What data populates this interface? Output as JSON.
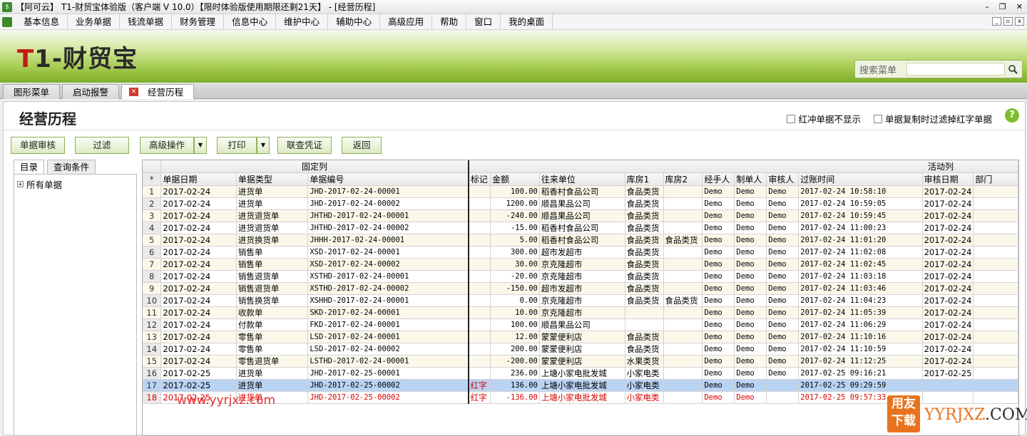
{
  "window": {
    "title": "【阿可云】 T1-财贸宝体验版（客户端 V 10.0）【限时体验版使用期限还剩21天】 - [经营历程]",
    "min": "–",
    "restore": "❐",
    "close": "✕"
  },
  "menu": [
    "基本信息",
    "业务单据",
    "钱流单据",
    "财务管理",
    "信息中心",
    "维护中心",
    "辅助中心",
    "高级应用",
    "帮助",
    "窗口",
    "我的桌面"
  ],
  "banner": {
    "logo_t": "T",
    "logo_rest": "1-财贸宝",
    "search_label": "搜索菜单",
    "search_value": ""
  },
  "tabs": [
    "图形菜单",
    "启动报警",
    "经营历程"
  ],
  "page": {
    "title": "经营历程",
    "opt1": "红冲单据不显示",
    "opt2": "单据复制时过滤掉红字单据",
    "help": "?"
  },
  "toolbar": {
    "audit": "单据审核",
    "filter": "过滤",
    "advanced": "高级操作",
    "print": "打印",
    "voucher": "联查凭证",
    "back": "返回"
  },
  "left": {
    "tab1": "目录",
    "tab2": "查询条件",
    "root": "所有单据"
  },
  "grid": {
    "group_fixed": "固定列",
    "group_active": "活动列",
    "headers": [
      "*",
      "单据日期",
      "单据类型",
      "单据编号",
      "标记",
      "金额",
      "往来单位",
      "库房1",
      "库房2",
      "经手人",
      "制单人",
      "审核人",
      "过账时间",
      "审核日期",
      "部门"
    ],
    "rows": [
      [
        "1",
        "2017-02-24",
        "进货单",
        "JHD-2017-02-24-00001",
        "",
        "100.00",
        "稻香村食品公司",
        "食品类货",
        "",
        "Demo",
        "Demo",
        "Demo",
        "2017-02-24 10:58:10",
        "2017-02-24",
        ""
      ],
      [
        "2",
        "2017-02-24",
        "进货单",
        "JHD-2017-02-24-00002",
        "",
        "1200.00",
        "顺昌果品公司",
        "食品类货",
        "",
        "Demo",
        "Demo",
        "Demo",
        "2017-02-24 10:59:05",
        "2017-02-24",
        ""
      ],
      [
        "3",
        "2017-02-24",
        "进货退货单",
        "JHTHD-2017-02-24-00001",
        "",
        "-240.00",
        "顺昌果品公司",
        "食品类货",
        "",
        "Demo",
        "Demo",
        "Demo",
        "2017-02-24 10:59:45",
        "2017-02-24",
        ""
      ],
      [
        "4",
        "2017-02-24",
        "进货退货单",
        "JHTHD-2017-02-24-00002",
        "",
        "-15.00",
        "稻香村食品公司",
        "食品类货",
        "",
        "Demo",
        "Demo",
        "Demo",
        "2017-02-24 11:00:23",
        "2017-02-24",
        ""
      ],
      [
        "5",
        "2017-02-24",
        "进货换货单",
        "JHHH-2017-02-24-00001",
        "",
        "5.00",
        "稻香村食品公司",
        "食品类货",
        "食品类货",
        "Demo",
        "Demo",
        "Demo",
        "2017-02-24 11:01:20",
        "2017-02-24",
        ""
      ],
      [
        "6",
        "2017-02-24",
        "销售单",
        "XSD-2017-02-24-00001",
        "",
        "300.00",
        "超市发超市",
        "食品类货",
        "",
        "Demo",
        "Demo",
        "Demo",
        "2017-02-24 11:02:08",
        "2017-02-24",
        ""
      ],
      [
        "7",
        "2017-02-24",
        "销售单",
        "XSD-2017-02-24-00002",
        "",
        "30.00",
        "京克隆超市",
        "食品类货",
        "",
        "Demo",
        "Demo",
        "Demo",
        "2017-02-24 11:02:45",
        "2017-02-24",
        ""
      ],
      [
        "8",
        "2017-02-24",
        "销售退货单",
        "XSTHD-2017-02-24-00001",
        "",
        "-20.00",
        "京克隆超市",
        "食品类货",
        "",
        "Demo",
        "Demo",
        "Demo",
        "2017-02-24 11:03:18",
        "2017-02-24",
        ""
      ],
      [
        "9",
        "2017-02-24",
        "销售退货单",
        "XSTHD-2017-02-24-00002",
        "",
        "-150.00",
        "超市发超市",
        "食品类货",
        "",
        "Demo",
        "Demo",
        "Demo",
        "2017-02-24 11:03:46",
        "2017-02-24",
        ""
      ],
      [
        "10",
        "2017-02-24",
        "销售换货单",
        "XSHHD-2017-02-24-00001",
        "",
        "0.00",
        "京克隆超市",
        "食品类货",
        "食品类货",
        "Demo",
        "Demo",
        "Demo",
        "2017-02-24 11:04:23",
        "2017-02-24",
        ""
      ],
      [
        "11",
        "2017-02-24",
        "收款单",
        "SKD-2017-02-24-00001",
        "",
        "10.00",
        "京克隆超市",
        "",
        "",
        "Demo",
        "Demo",
        "Demo",
        "2017-02-24 11:05:39",
        "2017-02-24",
        ""
      ],
      [
        "12",
        "2017-02-24",
        "付款单",
        "FKD-2017-02-24-00001",
        "",
        "100.00",
        "顺昌果品公司",
        "",
        "",
        "Demo",
        "Demo",
        "Demo",
        "2017-02-24 11:06:29",
        "2017-02-24",
        ""
      ],
      [
        "13",
        "2017-02-24",
        "零售单",
        "LSD-2017-02-24-00001",
        "",
        "12.00",
        "蒙蒙便利店",
        "食品类货",
        "",
        "Demo",
        "Demo",
        "Demo",
        "2017-02-24 11:10:16",
        "2017-02-24",
        ""
      ],
      [
        "14",
        "2017-02-24",
        "零售单",
        "LSD-2017-02-24-00002",
        "",
        "200.00",
        "蒙蒙便利店",
        "食品类货",
        "",
        "Demo",
        "Demo",
        "Demo",
        "2017-02-24 11:10:59",
        "2017-02-24",
        ""
      ],
      [
        "15",
        "2017-02-24",
        "零售退货单",
        "LSTHD-2017-02-24-00001",
        "",
        "-200.00",
        "蒙蒙便利店",
        "水果类货",
        "",
        "Demo",
        "Demo",
        "Demo",
        "2017-02-24 11:12:25",
        "2017-02-24",
        ""
      ],
      [
        "16",
        "2017-02-25",
        "进货单",
        "JHD-2017-02-25-00001",
        "",
        "236.00",
        "上塘小家电批发城",
        "小家电类",
        "",
        "Demo",
        "Demo",
        "Demo",
        "2017-02-25 09:16:21",
        "2017-02-25",
        ""
      ],
      [
        "17",
        "2017-02-25",
        "进货单",
        "JHD-2017-02-25-00002",
        "红字",
        "136.00",
        "上塘小家电批发城",
        "小家电类",
        "",
        "Demo",
        "Demo",
        "",
        "2017-02-25 09:29:59",
        "",
        ""
      ],
      [
        "18",
        "2017-02-25",
        "进货单",
        "JHD-2017-02-25-00002",
        "红字",
        "-136.00",
        "上塘小家电批发城",
        "小家电类",
        "",
        "Demo",
        "Demo",
        "",
        "2017-02-25 09:57:33",
        "",
        ""
      ]
    ]
  },
  "watermark": {
    "url": "www.yyrjxz.com",
    "logo": "用友下载",
    "brand": "YYRJXZ",
    "dom": ".COM"
  }
}
